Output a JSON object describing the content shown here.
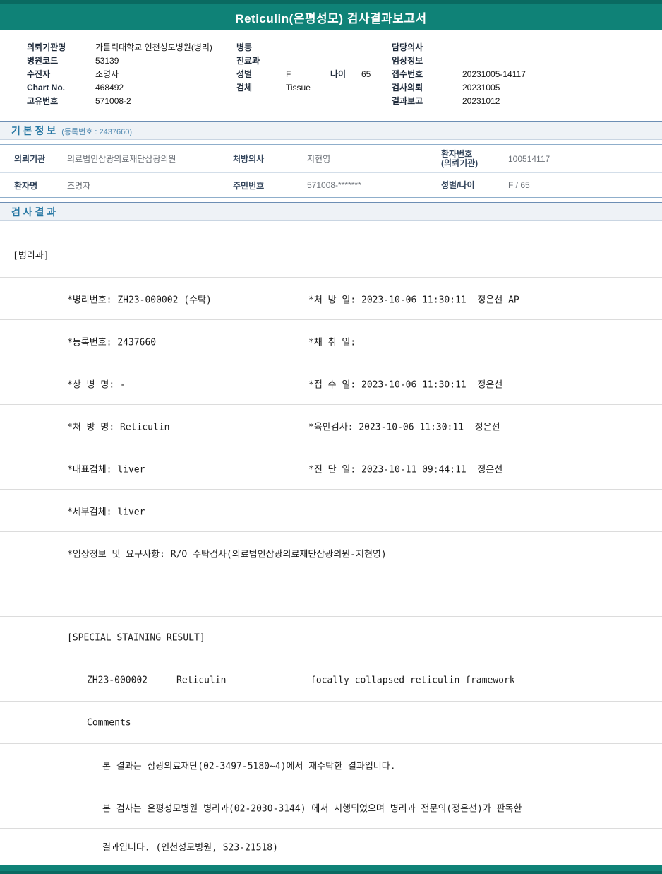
{
  "colors": {
    "header_teal": "#0F8277",
    "header_teal_dark": "#0A6A61",
    "section_title_blue": "#2677A3",
    "section_bar_bg": "#EEF2F6"
  },
  "report": {
    "title": "Reticulin(은평성모) 검사결과보고서"
  },
  "patient_header": {
    "left": [
      {
        "label": "의뢰기관명",
        "value": "가톨릭대학교 인천성모병원(병리)"
      },
      {
        "label": "병원코드",
        "value": "53139"
      },
      {
        "label": "수진자",
        "value": "조명자"
      },
      {
        "label": "Chart No.",
        "value": "468492"
      },
      {
        "label": "고유번호",
        "value": "571008-2"
      }
    ],
    "middle": {
      "ward_label": "병동",
      "ward_value": "",
      "dept_label": "진료과",
      "dept_value": "",
      "sex_label": "성별",
      "sex_value": "F",
      "age_label": "나이",
      "age_value": "65",
      "specimen_label": "검체",
      "specimen_value": "Tissue"
    },
    "right": [
      {
        "label": "담당의사",
        "value": ""
      },
      {
        "label": "임상정보",
        "value": ""
      },
      {
        "label": "접수번호",
        "value": "20231005-14117"
      },
      {
        "label": "검사의뢰",
        "value": "20231005"
      },
      {
        "label": "결과보고",
        "value": "20231012"
      }
    ]
  },
  "basic_info": {
    "title": "기 본 정 보",
    "reg_note": "(등록번호 : 2437660)",
    "row1": {
      "c1_label": "의뢰기관",
      "c1_value": "의료법인삼광의료재단삼광의원",
      "c2_label": "처방의사",
      "c2_value": "지현영",
      "c3_label_line1": "환자번호",
      "c3_label_line2": "(의뢰기관)",
      "c3_value": "100514117"
    },
    "row2": {
      "c1_label": "환자명",
      "c1_value": "조명자",
      "c2_label": "주민번호",
      "c2_value": "571008-*******",
      "c3_label": "성별/나이",
      "c3_value": "F / 65"
    }
  },
  "results": {
    "title": "검 사 결 과",
    "department": "[병리과]",
    "detail_lines": [
      {
        "left": "*병리번호: ZH23-000002 (수탁)",
        "right": "*처 방 일: 2023-10-06 11:30:11  정은선 AP"
      },
      {
        "left": "*등록번호: 2437660",
        "right": "*채 취 일:"
      },
      {
        "left": "*상 병 명: -",
        "right": "*접 수 일: 2023-10-06 11:30:11  정은선"
      },
      {
        "left": "*처 방 명: Reticulin",
        "right": "*육안검사: 2023-10-06 11:30:11  정은선"
      },
      {
        "left": "*대표검체: liver",
        "right": "*진 단 일: 2023-10-11 09:44:11  정은선"
      },
      {
        "left": "*세부검체: liver",
        "right": ""
      },
      {
        "left": "*임상정보 및 요구사항: R/O 수탁검사(의료법인삼광의료재단삼광의원-지현영)",
        "right": ""
      }
    ],
    "staining_section_title": "[SPECIAL STAINING RESULT]",
    "staining_result": {
      "code": "ZH23-000002",
      "stain": "Reticulin",
      "result": "focally collapsed reticulin framework"
    },
    "comments_label": "Comments",
    "comments": [
      "본 결과는 삼광의료재단(02-3497-5180~4)에서 재수탁한 결과입니다.",
      "본 검사는 은평성모병원 병리과(02-2030-3144) 에서 시행되었으며 병리과 전문의(정은선)가 판독한",
      "결과입니다. (인천성모병원, S23-21518)"
    ]
  }
}
